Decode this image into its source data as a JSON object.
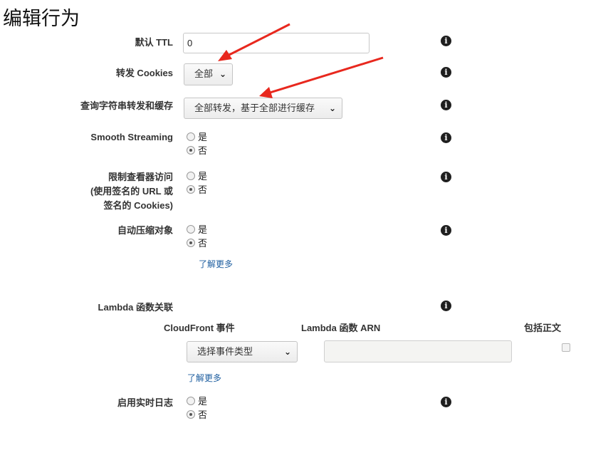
{
  "page_title": "编辑行为",
  "fields": {
    "default_ttl": {
      "label": "默认 TTL",
      "value": "0"
    },
    "forward_cookies": {
      "label": "转发 Cookies",
      "selected": "全部"
    },
    "query_string": {
      "label": "查询字符串转发和缓存",
      "selected": "全部转发，基于全部进行缓存"
    },
    "smooth_streaming": {
      "label": "Smooth Streaming",
      "yes": "是",
      "no": "否",
      "value": "否"
    },
    "restrict_viewer": {
      "label_lines": [
        "限制查看器访问",
        "(使用签名的 URL 或",
        "签名的 Cookies)"
      ],
      "yes": "是",
      "no": "否",
      "value": "否"
    },
    "compress": {
      "label": "自动压缩对象",
      "yes": "是",
      "no": "否",
      "value": "否",
      "learn_more": "了解更多"
    },
    "lambda": {
      "label": "Lambda 函数关联",
      "col_event": "CloudFront 事件",
      "col_arn": "Lambda 函数 ARN",
      "col_include_body": "包括正文",
      "event_select": "选择事件类型",
      "arn_value": "",
      "include_body_checked": false,
      "learn_more": "了解更多"
    },
    "realtime_logs": {
      "label": "启用实时日志",
      "yes": "是",
      "no": "否",
      "value": "否"
    }
  },
  "icons": {
    "info": "info-icon",
    "chevron": "chevron-down-icon",
    "annotation": "red-arrow-annotation"
  },
  "colors": {
    "link": "#1f5fa0",
    "arrow": "#e8281e",
    "info_bg": "#1f1f1f"
  }
}
